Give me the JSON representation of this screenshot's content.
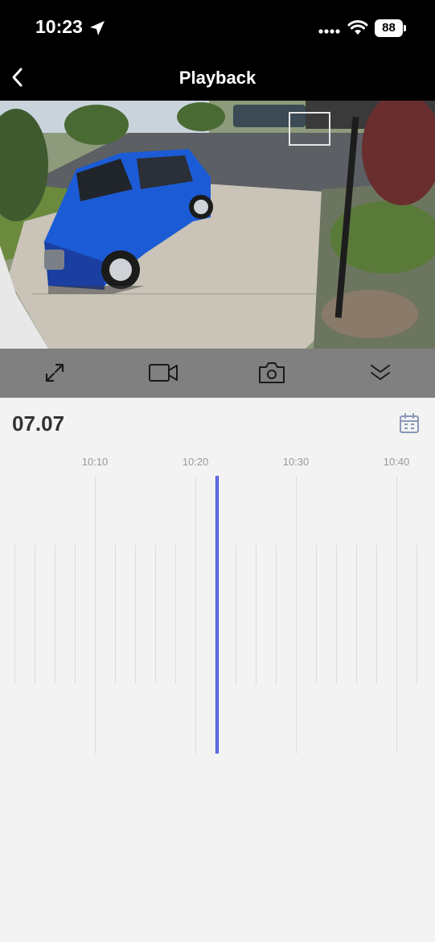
{
  "status_bar": {
    "time": "10:23",
    "battery": "88"
  },
  "nav": {
    "title": "Playback"
  },
  "toolbar": {
    "items": [
      {
        "name": "fullscreen",
        "icon": "expand-icon"
      },
      {
        "name": "record",
        "icon": "video-camera-icon"
      },
      {
        "name": "snapshot",
        "icon": "camera-icon"
      },
      {
        "name": "collapse",
        "icon": "double-chevron-down-icon"
      }
    ]
  },
  "date": {
    "label": "07.07"
  },
  "timeline": {
    "tick_labels": [
      "10:10",
      "10:20",
      "10:30",
      "10:40"
    ],
    "playhead_time": "10:22"
  },
  "colors": {
    "playhead": "#6c78e6",
    "toolbar_bg": "#808080",
    "header_bg": "#000000"
  }
}
